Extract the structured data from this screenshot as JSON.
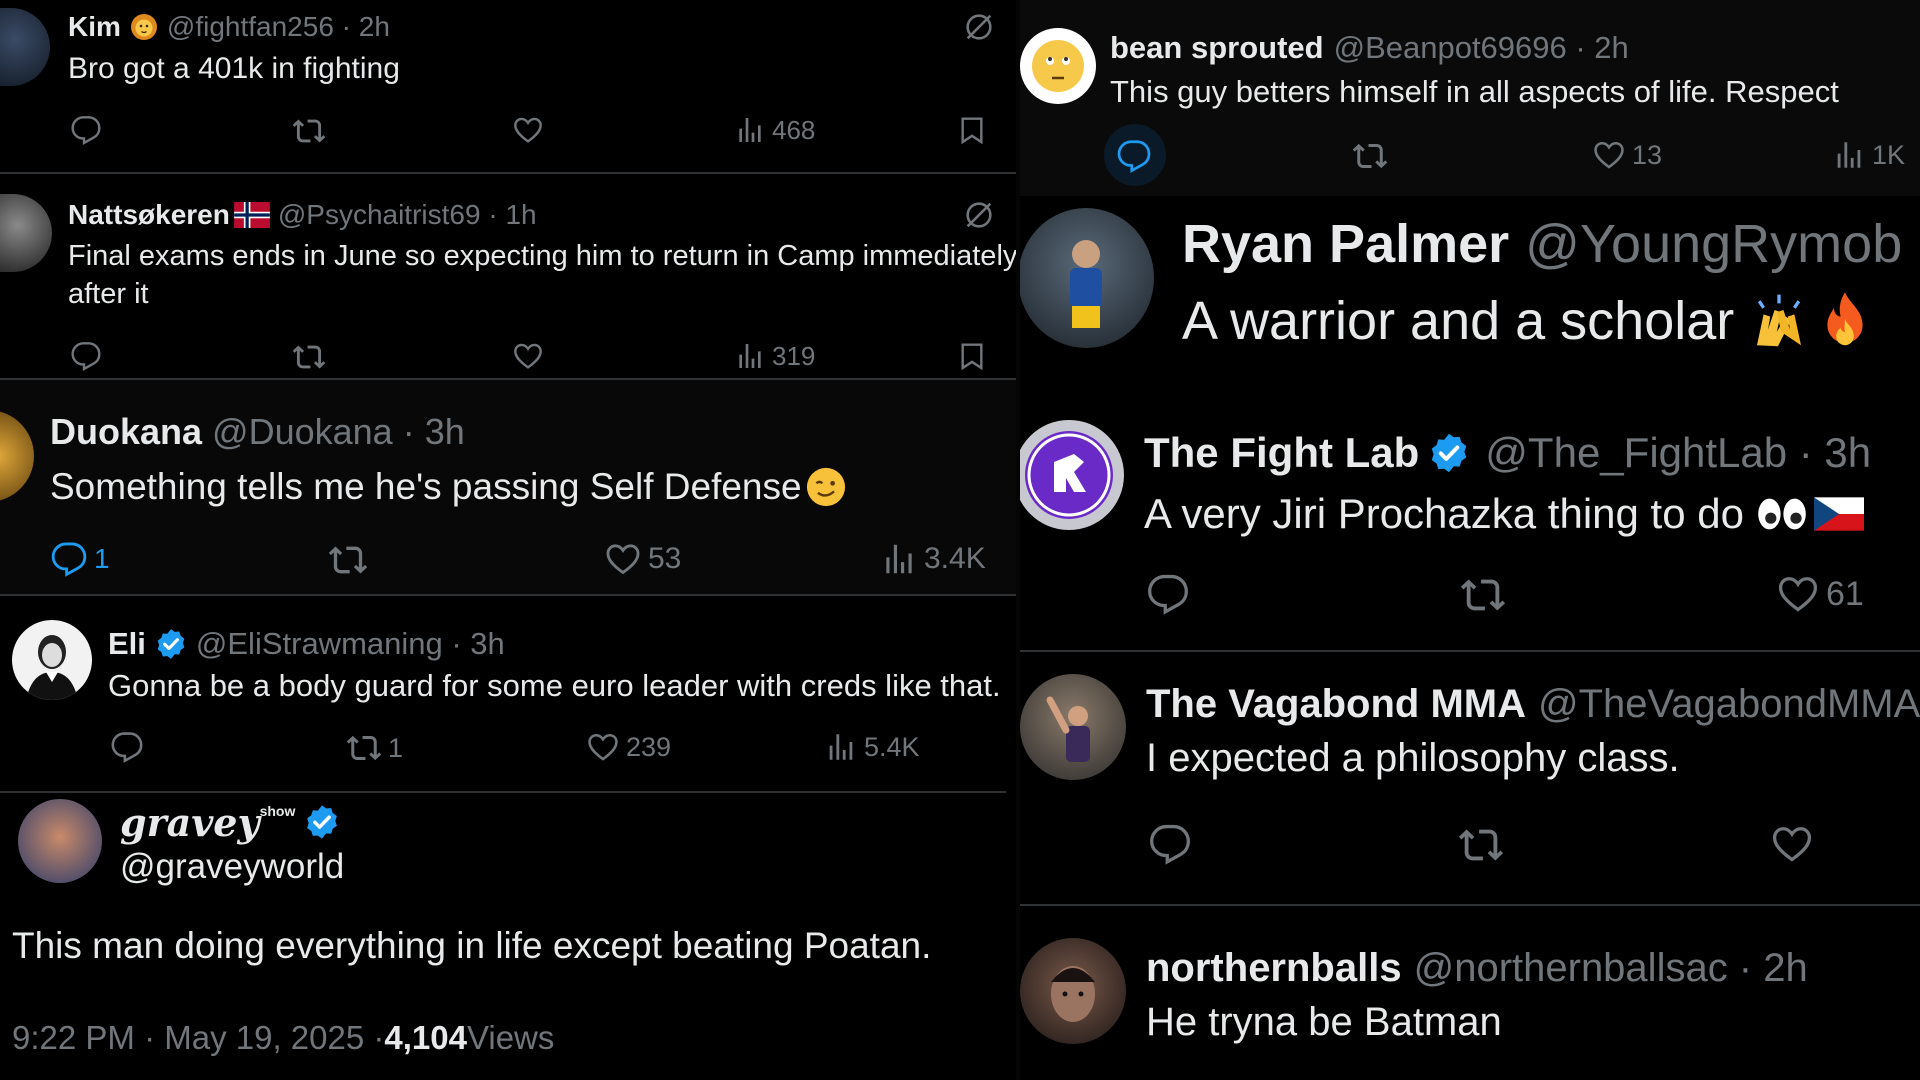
{
  "colors": {
    "background": "#000000",
    "text": "#e7e9ea",
    "muted": "#71767b",
    "divider": "#2f3336",
    "verified": "#1d9bf0",
    "reply_active": "#1d9bf0"
  },
  "left": {
    "t1": {
      "name": "Kim",
      "handle": "@fightfan256 · 2h",
      "text": "Bro got a 401k in fighting",
      "views": "468",
      "icons": [
        "lion-emoji-icon",
        "grok-icon",
        "reply-icon",
        "retweet-icon",
        "like-icon",
        "views-icon",
        "bookmark-icon"
      ]
    },
    "t2": {
      "name": "Nattsøkeren",
      "handle": "@Psychaitrist69 · 1h",
      "text_line1": "Final exams ends in June so expecting him to return in Camp immediately",
      "text_line2": "after it",
      "views": "319"
    },
    "t3": {
      "name": "Duokana",
      "handle": "@Duokana · 3h",
      "text": "Something tells me he's passing Self Defense",
      "replies": "1",
      "likes": "53",
      "views": "3.4K"
    },
    "t4": {
      "name": "Eli",
      "handle": "@EliStrawmaning · 3h",
      "text": "Gonna be a body guard for some euro leader with creds like that.",
      "retweets": "1",
      "likes": "239",
      "views": "5.4K"
    },
    "t5": {
      "name": "gravey",
      "name_sup": "show",
      "handle": "@graveyworld",
      "text": "This man doing everything in life except beating Poatan.",
      "time": "9:22 PM · May 19, 2025 · ",
      "views_count": "4,104",
      "views_label": " Views"
    }
  },
  "right": {
    "t1": {
      "name": "bean sprouted",
      "handle": "@Beanpot69696 · 2h",
      "text": "This guy betters himself in all aspects of life. Respect",
      "likes": "13",
      "views": "1K"
    },
    "t2": {
      "name": "Ryan Palmer",
      "handle": "@YoungRymob ·",
      "text": "A warrior and a scholar"
    },
    "t3": {
      "name": "The Fight Lab",
      "handle": "@The_FightLab · 3h",
      "text": "A very Jiri Prochazka thing to do",
      "likes": "61"
    },
    "t4": {
      "name": "The Vagabond MMA",
      "handle": "@TheVagabondMMA",
      "text": "I expected a philosophy class."
    },
    "t5": {
      "name": "northernballs",
      "handle": "@northernballsac · 2h",
      "text": "He tryna be Batman"
    }
  }
}
